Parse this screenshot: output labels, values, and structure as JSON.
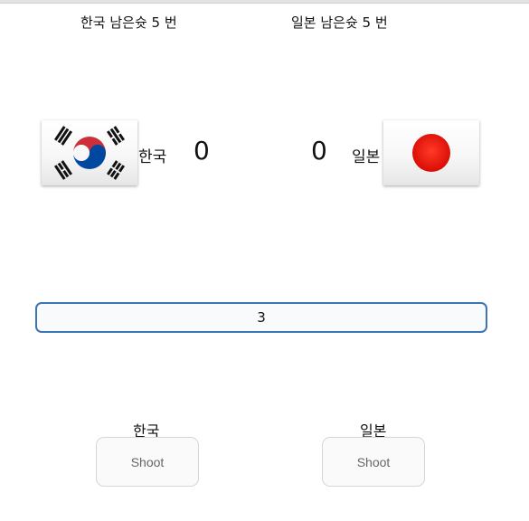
{
  "header": {
    "korea_shots_left": "한국 남은슛 5 번",
    "japan_shots_left": "일본 남은슛 5 번"
  },
  "scoreboard": {
    "korea": {
      "name": "한국",
      "score": "0",
      "flag_icon": "south-korea-flag-icon"
    },
    "japan": {
      "name": "일본",
      "score": "0",
      "flag_icon": "japan-flag-icon"
    }
  },
  "round_display": {
    "value": "3"
  },
  "controls": {
    "korea": {
      "label": "한국",
      "button_label": "Shoot"
    },
    "japan": {
      "label": "일본",
      "button_label": "Shoot"
    }
  },
  "colors": {
    "accent_border": "#3d74b4",
    "japan_red": "#e8130c",
    "korea_red": "#cd2e3a",
    "korea_blue": "#0047a0"
  }
}
